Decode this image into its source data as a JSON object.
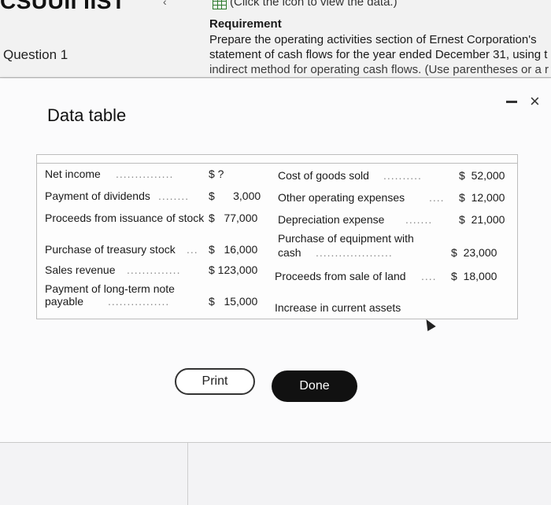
{
  "header": {
    "title": "CSUUII IIST",
    "data_hint": "(Click the icon to view the data.)",
    "question_label": "Question 1"
  },
  "requirement": {
    "heading": "Requirement",
    "line1": "Prepare the operating activities section of Ernest Corporation's",
    "line2": "statement of cash flows for the year ended December 31, using t",
    "line3": "indirect method for operating cash flows. (Use parentheses or a r"
  },
  "dialog": {
    "title": "Data table",
    "minimize_icon": "minimize-icon",
    "close_icon": "×",
    "left_column": [
      {
        "label": "Net income",
        "dots": "...............",
        "amount": "$ ?"
      },
      {
        "label": "Payment of dividends",
        "dots": "........",
        "amount": "$      3,000"
      },
      {
        "label": "Proceeds from issuance of stock",
        "dots": "",
        "amount": "$   77,000"
      },
      {
        "label": "Purchase of treasury stock",
        "dots": "...",
        "amount": "$   16,000"
      },
      {
        "label": "Sales revenue",
        "dots": "..............",
        "amount": "$ 123,000"
      },
      {
        "label": "Payment of long-term note",
        "label2": "payable",
        "dots": "................",
        "amount": "$   15,000"
      }
    ],
    "right_column": [
      {
        "label": "Cost of goods sold",
        "dots": "..........",
        "amount": "$  52,000"
      },
      {
        "label": "Other operating expenses",
        "dots": "....",
        "amount": "$  12,000"
      },
      {
        "label": "Depreciation expense",
        "dots": ".......",
        "amount": "$  21,000"
      },
      {
        "label": "Purchase of equipment with",
        "label2": "cash",
        "dots": "....................",
        "amount": "$  23,000"
      },
      {
        "label": "Proceeds from sale of land",
        "dots": "....",
        "amount": "$  18,000"
      },
      {
        "label": "Increase in current assets",
        "dots": "",
        "amount": ""
      }
    ],
    "print_label": "Print",
    "done_label": "Done"
  }
}
